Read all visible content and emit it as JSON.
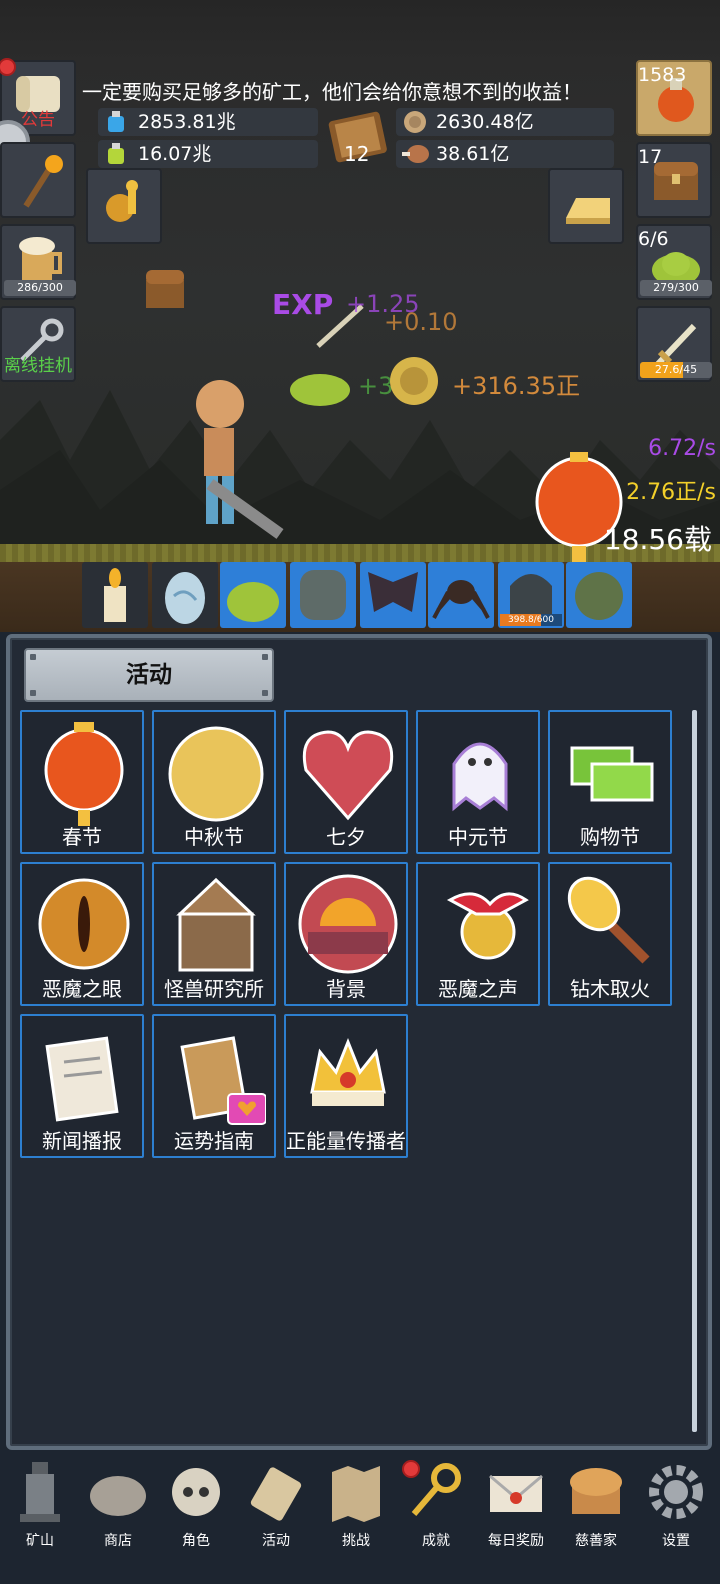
{
  "notice": "一定要购买足够多的矿工，他们会给你意想不到的收益！",
  "resources": {
    "blue_potion": "2853.81兆",
    "green_potion": "16.07兆",
    "book_count": "12",
    "coin": "2630.48亿",
    "meat": "38.61亿"
  },
  "left_buttons": {
    "announcement": "公告",
    "beer_capacity": "286/300",
    "offline": "离线挂机"
  },
  "right_buttons": {
    "potion_count": "1583",
    "chest_count": "17",
    "slime_count": "6/6",
    "slime_capacity": "279/300",
    "sword_capacity": "27.6/45"
  },
  "floating": {
    "exp_badge": "EXP",
    "exp_gain": "+1.25",
    "sword_gain": "+0.10",
    "slime_gain": "+3",
    "coin_gain": "+316.35正"
  },
  "rates": {
    "purple_rate": "6.72/s",
    "yellow_rate": "2.76正/s",
    "lantern_value": "18.56载"
  },
  "monster_bar": "398.8/600",
  "panel": {
    "title": "活动",
    "tiles": [
      {
        "label": "春节",
        "icon": "lantern-icon"
      },
      {
        "label": "中秋节",
        "icon": "moon-icon"
      },
      {
        "label": "七夕",
        "icon": "heart-icon"
      },
      {
        "label": "中元节",
        "icon": "ghost-icon"
      },
      {
        "label": "购物节",
        "icon": "money-icon"
      },
      {
        "label": "恶魔之眼",
        "icon": "demon-eye-icon"
      },
      {
        "label": "怪兽研究所",
        "icon": "monster-lab-icon"
      },
      {
        "label": "背景",
        "icon": "sunset-icon"
      },
      {
        "label": "恶魔之声",
        "icon": "bell-icon"
      },
      {
        "label": "钻木取火",
        "icon": "torch-icon"
      },
      {
        "label": "新闻播报",
        "icon": "newspaper-icon"
      },
      {
        "label": "运势指南",
        "icon": "fortune-icon"
      },
      {
        "label": "正能量传播者",
        "icon": "crown-icon"
      }
    ]
  },
  "nav": [
    {
      "label": "矿山",
      "icon": "lantern-icon"
    },
    {
      "label": "商店",
      "icon": "ore-icon"
    },
    {
      "label": "角色",
      "icon": "skull-icon"
    },
    {
      "label": "活动",
      "icon": "scroll-icon"
    },
    {
      "label": "挑战",
      "icon": "map-icon"
    },
    {
      "label": "成就",
      "icon": "key-icon"
    },
    {
      "label": "每日奖励",
      "icon": "letter-icon"
    },
    {
      "label": "慈善家",
      "icon": "bread-icon"
    },
    {
      "label": "设置",
      "icon": "gear-icon"
    }
  ],
  "colors": {
    "tile_border": "#2d7fd0",
    "panel_bg": "#232a35",
    "purple": "#a94be6",
    "yellow": "#f3d02a",
    "orange": "#d38a3c",
    "green_text": "#5ad04a",
    "announce_red": "#e23a3a"
  }
}
